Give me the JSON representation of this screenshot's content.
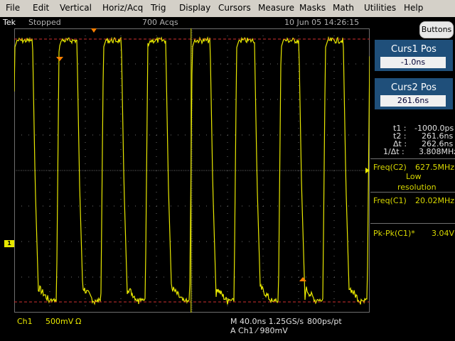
{
  "menu": [
    "File",
    "Edit",
    "Vertical",
    "Horiz/Acq",
    "Trig",
    "Display",
    "Cursors",
    "Measure",
    "Masks",
    "Math",
    "Utilities",
    "Help"
  ],
  "status": {
    "brand": "Tek",
    "state": "Stopped",
    "acqs": "700 Acqs",
    "datetime": "10 Jun 05 14:26:15"
  },
  "buttons_label": "Buttons",
  "curs1": {
    "title": "Curs1 Pos",
    "value": "-1.0ns"
  },
  "curs2": {
    "title": "Curs2 Pos",
    "value": "261.6ns"
  },
  "cursor_readout": {
    "t1_label": "t1 :",
    "t1": "-1000.0ps",
    "t2_label": "t2 :",
    "t2": "261.6ns",
    "dt_label": "Δt :",
    "dt": "262.6ns",
    "inv_label": "1/Δt :",
    "inv": "3.808MHz"
  },
  "measurements": {
    "freq_c2_label": "Freq(C2)",
    "freq_c2": "627.5MHz",
    "freq_c2_note1": "Low",
    "freq_c2_note2": "resolution",
    "freq_c1_label": "Freq(C1)",
    "freq_c1": "20.02MHz",
    "pkpk_label": "Pk-Pk(C1)*",
    "pkpk": "3.04V"
  },
  "bottom": {
    "ch": "Ch1",
    "scale": "500mV",
    "coupling": "Ω",
    "timebase": "M 40.0ns 1.25GS/s",
    "rec": "800ps/pt",
    "trig": "A  Ch1  ⁄  980mV"
  },
  "ch1_marker": "1",
  "colors": {
    "trace": "#e8e800",
    "grid": "#6e6e6e",
    "cursor_line": "#e0e000",
    "cursor_dashed": "#d03030",
    "marker": "#ff8000",
    "panel_box": "#1f4f7a"
  },
  "waveform": {
    "cycles": 8,
    "high_level_div": 3.7,
    "low_level_div": -3.7,
    "period_ns": 49.95,
    "volts_per_div": 0.5,
    "ns_per_div": 40
  },
  "cursors": {
    "vertical_ns": [
      -1.0,
      261.6
    ],
    "h_levels_div": [
      3.7,
      -3.7
    ]
  }
}
